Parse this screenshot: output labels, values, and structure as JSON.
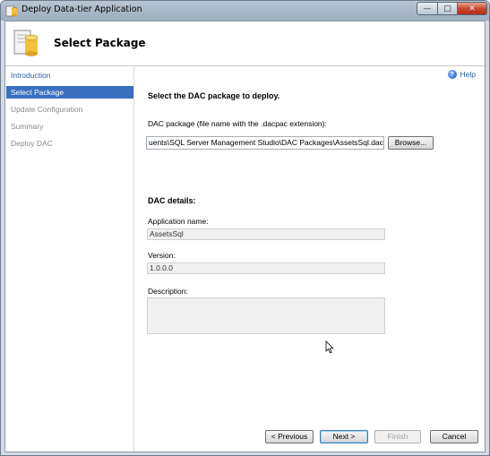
{
  "window": {
    "title": "Deploy Data-tier Application"
  },
  "header": {
    "title": "Select Package"
  },
  "nav": {
    "items": [
      {
        "label": "Introduction",
        "state": "link"
      },
      {
        "label": "Select Package",
        "state": "active"
      },
      {
        "label": "Update Configuration",
        "state": "disabled"
      },
      {
        "label": "Summary",
        "state": "disabled"
      },
      {
        "label": "Deploy DAC",
        "state": "disabled"
      }
    ]
  },
  "content": {
    "help_label": "Help",
    "heading": "Select the DAC package to deploy.",
    "package_label": "DAC package (file name with the .dacpac extension):",
    "package_value": "uents\\SQL Server Management Studio\\DAC Packages\\AssetsSql.dacpac",
    "browse_label": "Browse...",
    "details_heading": "DAC details:",
    "app_name_label": "Application name:",
    "app_name_value": "AssetsSql",
    "version_label": "Version:",
    "version_value": "1.0.0.0",
    "description_label": "Description:",
    "description_value": ""
  },
  "footer": {
    "previous_label": "< Previous",
    "next_label": "Next >",
    "finish_label": "Finish",
    "cancel_label": "Cancel"
  },
  "colors": {
    "accent": "#3a6fbf",
    "link": "#2a5fa8",
    "close_button": "#c7432b"
  }
}
